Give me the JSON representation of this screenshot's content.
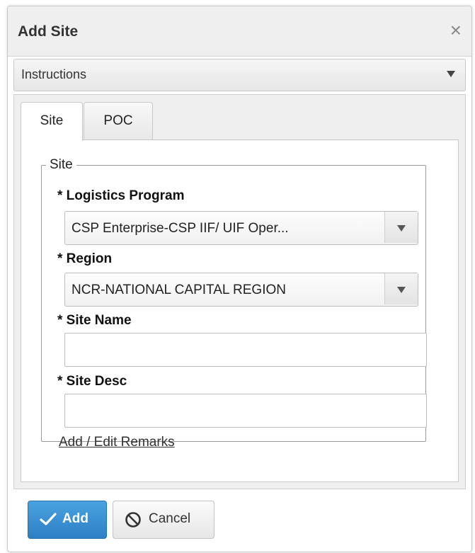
{
  "dialog": {
    "title": "Add Site",
    "close_glyph": "×",
    "instructions_label": "Instructions"
  },
  "tabs": [
    {
      "label": "Site",
      "active": true
    },
    {
      "label": "POC",
      "active": false
    }
  ],
  "site_section": {
    "legend": "Site",
    "logistics_program": {
      "label": "* Logistics Program",
      "value": "CSP Enterprise-CSP IIF/ UIF Oper..."
    },
    "region": {
      "label": "* Region",
      "value": "NCR-NATIONAL CAPITAL REGION"
    },
    "site_name": {
      "label": "* Site Name",
      "value": ""
    },
    "site_desc": {
      "label": "* Site Desc",
      "value": ""
    },
    "remarks_link": "Add / Edit Remarks"
  },
  "footer": {
    "add_label": "Add",
    "cancel_label": "Cancel"
  },
  "colors": {
    "primary": "#2c7fc4",
    "header_bg": "#efefef"
  },
  "icons": {
    "close": "close-icon",
    "instructions_toggle": "caret-down-icon",
    "select_toggle": "caret-down-icon",
    "add": "check-icon",
    "cancel": "ban-icon"
  }
}
